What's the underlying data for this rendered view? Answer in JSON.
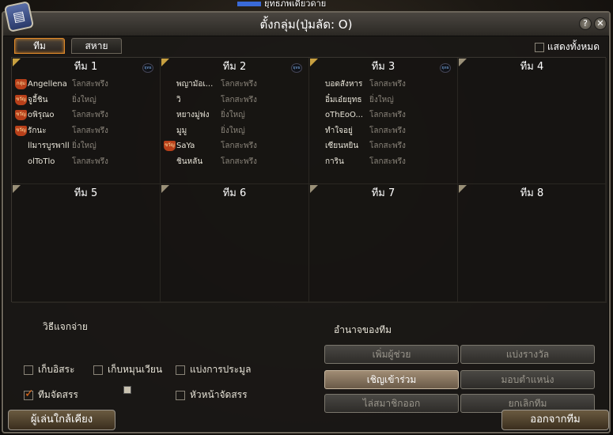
{
  "top_strip_text": "ยุทธภพเดียวดาย",
  "window": {
    "title": "ตั้งกลุ่ม(ปุ่มลัด: O)",
    "help_glyph": "?",
    "close_glyph": "✕",
    "app_icon_glyph": "▤"
  },
  "tabs": [
    {
      "label": "ทีม",
      "active": true
    },
    {
      "label": "สหาย",
      "active": false
    }
  ],
  "show_all_label": "แสดงทั้งหมด",
  "show_all_checked": false,
  "ok_badge": "ยุทธ",
  "teams": [
    {
      "name": "ทีม 1",
      "badge": true,
      "members": [
        {
          "rank": "กลุ่ม",
          "name": "Angellena",
          "server": "โลกสะพรึง"
        },
        {
          "rank": "ขวัญ",
          "name": "จูอี้ชิน",
          "server": "ยิ่งใหญ่"
        },
        {
          "rank": "ขวัญ",
          "name": "oพิรุณo",
          "server": "โลกสะพรึง"
        },
        {
          "rank": "ขวัญ",
          "name": "รักนะ",
          "server": "โลกสะพรึง"
        },
        {
          "rank": "",
          "name": "llมารบูรพาll",
          "server": "ยิ่งใหญ่"
        },
        {
          "rank": "",
          "name": "olToTlo",
          "server": "โลกสะพรึง"
        }
      ]
    },
    {
      "name": "ทีม 2",
      "badge": true,
      "members": [
        {
          "rank": "",
          "name": "พญามัอเ...",
          "server": "โลกสะพรึง"
        },
        {
          "rank": "",
          "name": "วิ",
          "server": "โลกสะพรึง"
        },
        {
          "rank": "",
          "name": "หยางมู่ฟง",
          "server": "ยิ่งใหญ่"
        },
        {
          "rank": "",
          "name": "มูมู",
          "server": "ยิ่งใหญ่"
        },
        {
          "rank": "ขวัญ",
          "name": "SaYa",
          "server": "โลกสะพรึง"
        },
        {
          "rank": "",
          "name": "ชินหลัน",
          "server": "โลกสะพรึง"
        }
      ]
    },
    {
      "name": "ทีม 3",
      "badge": true,
      "members": [
        {
          "rank": "",
          "name": "บอดสังหาร",
          "server": "โลกสะพรึง"
        },
        {
          "rank": "",
          "name": "อิ๋มเอ๋ยยุทธ",
          "server": "ยิ่งใหญ่"
        },
        {
          "rank": "",
          "name": "oThEoO...",
          "server": "โลกสะพรึง"
        },
        {
          "rank": "",
          "name": "ทำใจอยู่",
          "server": "โลกสะพรึง"
        },
        {
          "rank": "",
          "name": "เซียนหยิน",
          "server": "โลกสะพรึง"
        },
        {
          "rank": "",
          "name": "การิน",
          "server": "โลกสะพรึง"
        }
      ]
    },
    {
      "name": "ทีม 4",
      "badge": false,
      "members": []
    },
    {
      "name": "ทีม 5",
      "badge": false,
      "members": []
    },
    {
      "name": "ทีม 6",
      "badge": false,
      "members": []
    },
    {
      "name": "ทีม 7",
      "badge": false,
      "members": []
    },
    {
      "name": "ทีม 8",
      "badge": false,
      "members": []
    }
  ],
  "distribution": {
    "title": "วิธีแจกจ่าย",
    "options": [
      {
        "label": "เก็บอิสระ",
        "checked": false
      },
      {
        "label": "เก็บหมุนเวียน",
        "checked": false
      },
      {
        "label": "แบ่งการประมูล",
        "checked": false
      },
      {
        "label": "ทีมจัดสรร",
        "checked": true
      },
      {
        "label": "หัวหน้าจัดสรร",
        "checked": false
      }
    ]
  },
  "team_power": {
    "title": "อำนาจของทีม",
    "buttons": [
      {
        "label": "เพิ่มผู้ช่วย",
        "enabled": false
      },
      {
        "label": "แบ่งรางวัล",
        "enabled": false
      },
      {
        "label": "เชิญเข้าร่วม",
        "enabled": true
      },
      {
        "label": "มอบตำแหน่ง",
        "enabled": false
      },
      {
        "label": "ไล่สมาชิกออก",
        "enabled": false
      },
      {
        "label": "ยกเลิกทีม",
        "enabled": false
      }
    ]
  },
  "footer": {
    "nearby_players": "ผู้เล่นใกล้เคียง",
    "leave_team": "ออกจากทีม"
  }
}
